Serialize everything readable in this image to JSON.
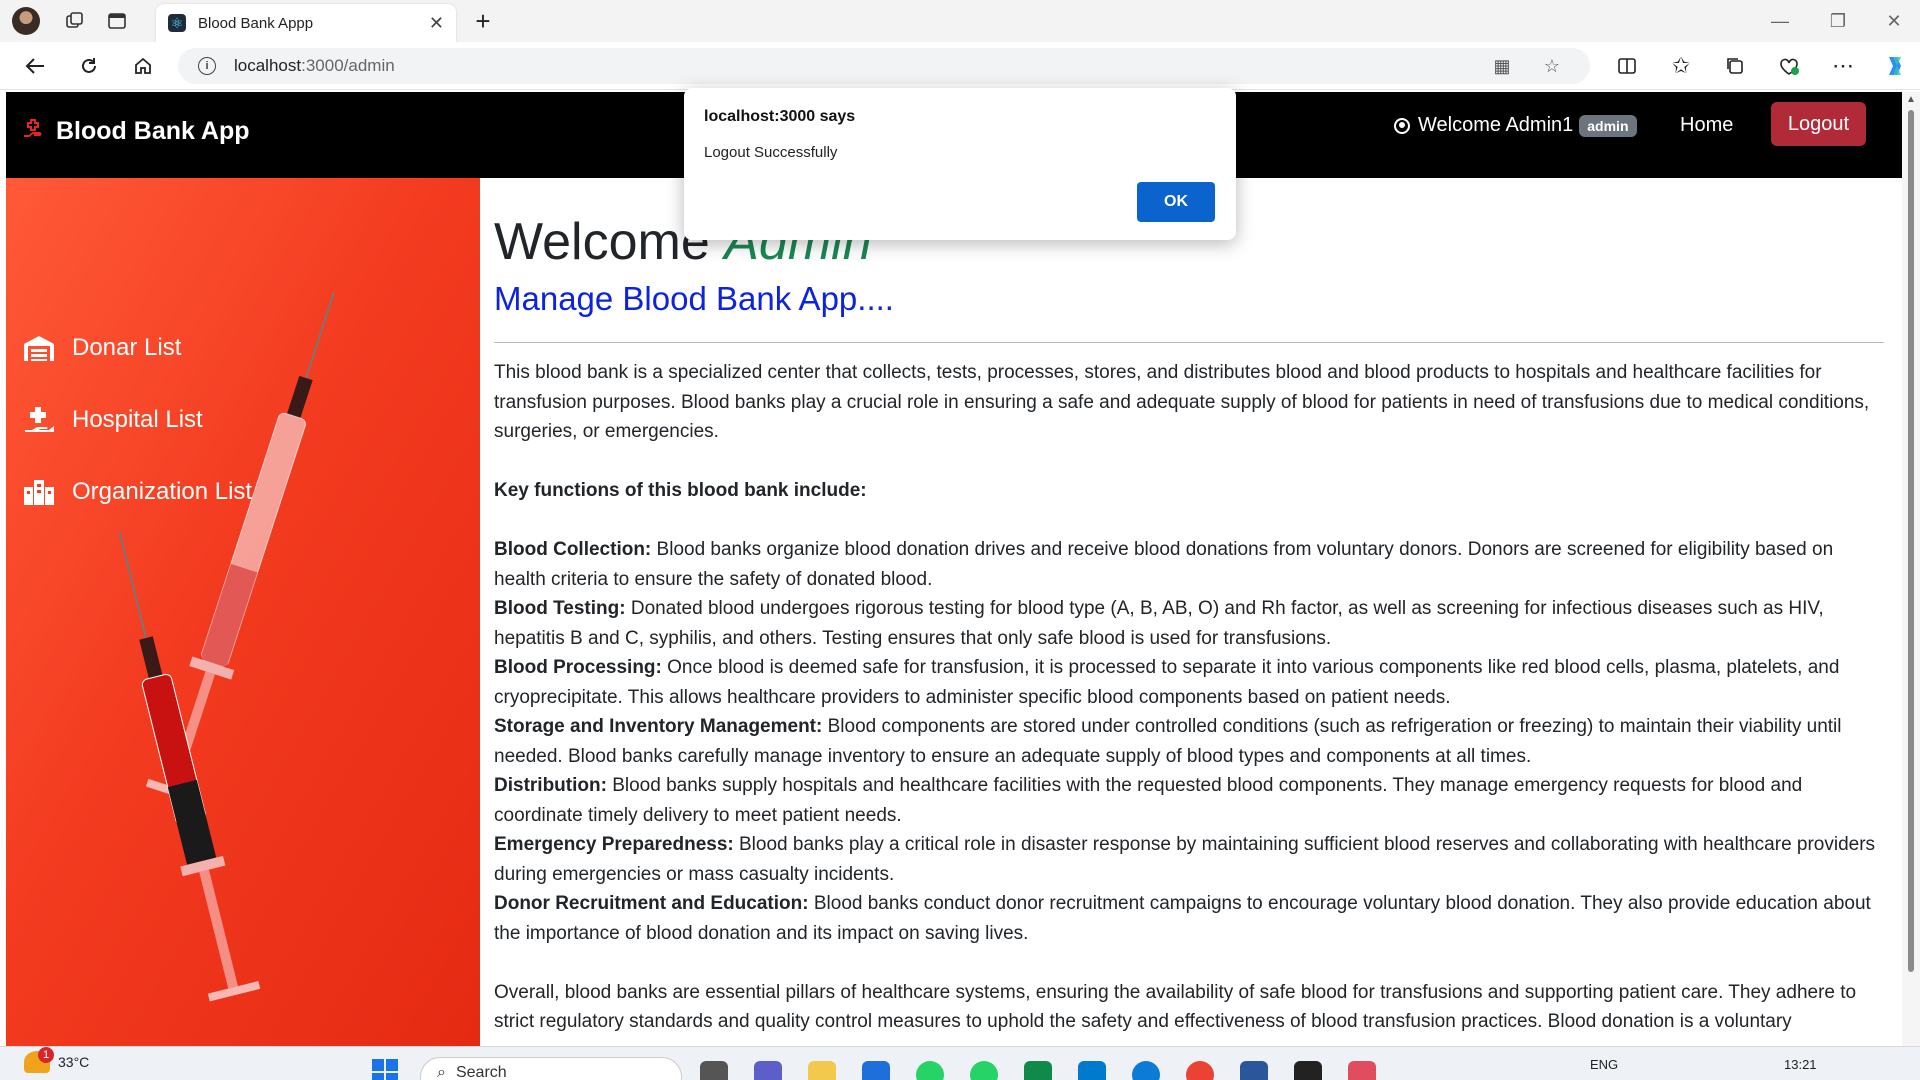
{
  "browser": {
    "tab_title": "Blood Bank Appp",
    "url_host": "localhost",
    "url_rest": ":3000/admin"
  },
  "navbar": {
    "brand": "Blood Bank App",
    "welcome_text": "Welcome Admin1",
    "role_badge": "admin",
    "home_label": "Home",
    "logout_label": "Logout"
  },
  "sidebar": {
    "items": [
      {
        "label": "Donar List",
        "icon": "warehouse-icon"
      },
      {
        "label": "Hospital List",
        "icon": "hand-holding-medical-icon"
      },
      {
        "label": "Organization List",
        "icon": "building-icon"
      }
    ]
  },
  "content": {
    "welcome_word": "Welcome",
    "welcome_role": "Admin",
    "sub_heading": "Manage Blood Bank App....",
    "intro": "This blood bank is a specialized center that collects, tests, processes, stores, and distributes blood and blood products to hospitals and healthcare facilities for transfusion purposes. Blood banks play a crucial role in ensuring a safe and adequate supply of blood for patients in need of transfusions due to medical conditions, surgeries, or emergencies.",
    "key_functions_heading": "Key functions of this blood bank include:",
    "functions": [
      {
        "title": "Blood Collection:",
        "text": " Blood banks organize blood donation drives and receive blood donations from voluntary donors. Donors are screened for eligibility based on health criteria to ensure the safety of donated blood."
      },
      {
        "title": "Blood Testing:",
        "text": " Donated blood undergoes rigorous testing for blood type (A, B, AB, O) and Rh factor, as well as screening for infectious diseases such as HIV, hepatitis B and C, syphilis, and others. Testing ensures that only safe blood is used for transfusions."
      },
      {
        "title": "Blood Processing:",
        "text": " Once blood is deemed safe for transfusion, it is processed to separate it into various components like red blood cells, plasma, platelets, and cryoprecipitate. This allows healthcare providers to administer specific blood components based on patient needs."
      },
      {
        "title": "Storage and Inventory Management:",
        "text": " Blood components are stored under controlled conditions (such as refrigeration or freezing) to maintain their viability until needed. Blood banks carefully manage inventory to ensure an adequate supply of blood types and components at all times."
      },
      {
        "title": "Distribution:",
        "text": " Blood banks supply hospitals and healthcare facilities with the requested blood components. They manage emergency requests for blood and coordinate timely delivery to meet patient needs."
      },
      {
        "title": "Emergency Preparedness:",
        "text": " Blood banks play a critical role in disaster response by maintaining sufficient blood reserves and collaborating with healthcare providers during emergencies or mass casualty incidents."
      },
      {
        "title": "Donor Recruitment and Education:",
        "text": " Blood banks conduct donor recruitment campaigns to encourage voluntary blood donation. They also provide education about the importance of blood donation and its impact on saving lives."
      }
    ],
    "overall": "Overall, blood banks are essential pillars of healthcare systems, ensuring the availability of safe blood for transfusions and supporting patient care. They adhere to strict regulatory standards and quality control measures to uphold the safety and effectiveness of blood transfusion practices. Blood donation is a voluntary"
  },
  "alert": {
    "title": "localhost:3000 says",
    "message": "Logout Successfully",
    "ok_label": "OK"
  },
  "taskbar": {
    "temperature": "33°C",
    "weather_badge": "1",
    "search_placeholder": "Search",
    "language": "ENG",
    "time": "13:21"
  },
  "colors": {
    "navbar_bg": "#000000",
    "brand_icon": "#e2242b",
    "logout_bg": "#b02a37",
    "role_badge_bg": "#6c757d",
    "sidebar_red": "#f33b20",
    "role_text": "#198754",
    "sub_heading": "#0d23e0",
    "alert_ok": "#0b63ce"
  }
}
